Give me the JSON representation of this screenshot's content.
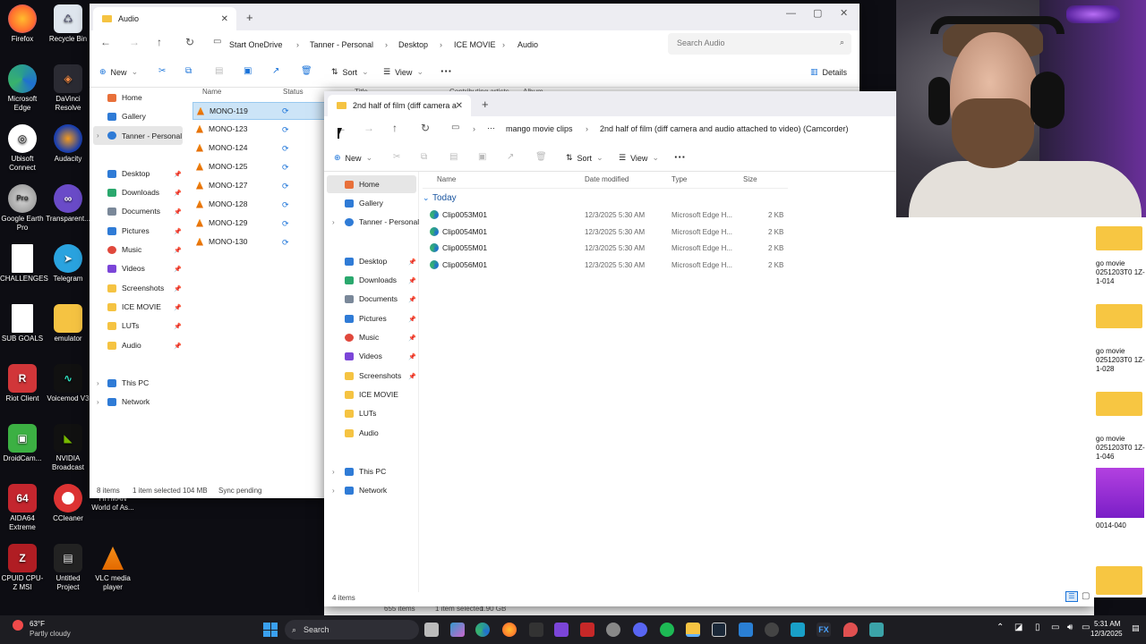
{
  "desktop": {
    "icons_left": [
      "Firefox",
      "Microsoft Edge",
      "Ubisoft Connect",
      "Google Earth Pro",
      "CHALLENGES",
      "SUB GOALS",
      "Riot Client",
      "DroidCam...",
      "AIDA64 Extreme",
      "CPUID CPU-Z MSI"
    ],
    "icons_right": [
      "Recycle Bin",
      "DaVinci Resolve",
      "Audacity",
      "Transparent...",
      "Telegram",
      "emulator",
      "Voicemod V3",
      "NVIDIA Broadcast",
      "CCleaner",
      "Untitled Project"
    ],
    "icons_third": [
      "HITMAN World of As...",
      "VLC media player"
    ]
  },
  "back_window": {
    "tab_title": "Audio",
    "breadcrumbs": [
      "Start OneDrive",
      "Tanner - Personal",
      "Desktop",
      "ICE MOVIE",
      "Audio"
    ],
    "search_placeholder": "Search Audio",
    "commands": {
      "new": "New",
      "sort": "Sort",
      "view": "View",
      "details": "Details"
    },
    "nav": {
      "home": "Home",
      "gallery": "Gallery",
      "onedrive": "Tanner - Personal",
      "quick": [
        "Desktop",
        "Downloads",
        "Documents",
        "Pictures",
        "Music",
        "Videos",
        "Screenshots",
        "ICE MOVIE",
        "LUTs",
        "Audio"
      ],
      "this_pc": "This PC",
      "network": "Network"
    },
    "columns": {
      "name": "Name",
      "status": "Status",
      "title": "Title",
      "contributing": "Contributing artists",
      "album": "Album"
    },
    "files": [
      "MONO-119",
      "MONO-123",
      "MONO-124",
      "MONO-125",
      "MONO-127",
      "MONO-128",
      "MONO-129",
      "MONO-130"
    ],
    "status": {
      "count": "8 items",
      "selected": "1 item selected",
      "size": "104 MB",
      "sync": "Sync pending"
    }
  },
  "front_window": {
    "tab_title": "2nd half of film (diff camera a",
    "breadcrumbs": [
      "mango movie clips",
      "2nd half of film (diff camera and audio attached to video) (Camcorder)"
    ],
    "commands": {
      "new": "New",
      "sort": "Sort",
      "view": "View"
    },
    "nav": {
      "home": "Home",
      "gallery": "Gallery",
      "onedrive": "Tanner - Personal",
      "quick": [
        "Desktop",
        "Downloads",
        "Documents",
        "Pictures",
        "Music",
        "Videos",
        "Screenshots",
        "ICE MOVIE",
        "LUTs",
        "Audio"
      ],
      "this_pc": "This PC",
      "network": "Network"
    },
    "columns": {
      "name": "Name",
      "date": "Date modified",
      "type": "Type",
      "size": "Size"
    },
    "group": "Today",
    "files": [
      {
        "name": "Clip0053M01",
        "date": "12/3/2025 5:30 AM",
        "type": "Microsoft Edge H...",
        "size": "2 KB"
      },
      {
        "name": "Clip0054M01",
        "date": "12/3/2025 5:30 AM",
        "type": "Microsoft Edge H...",
        "size": "2 KB"
      },
      {
        "name": "Clip0055M01",
        "date": "12/3/2025 5:30 AM",
        "type": "Microsoft Edge H...",
        "size": "2 KB"
      },
      {
        "name": "Clip0056M01",
        "date": "12/3/2025 5:30 AM",
        "type": "Microsoft Edge H...",
        "size": "2 KB"
      }
    ],
    "status": {
      "count": "4 items"
    }
  },
  "underlay": {
    "items": "655 items",
    "selected": "1 item selected",
    "size": "1.90 GB"
  },
  "right_strip": [
    "go movie 0251203T0 1Z-1-014",
    "go movie 0251203T0 1Z-1-028",
    "go movie 0251203T0 1Z-1-046",
    "0014-040"
  ],
  "taskbar": {
    "weather_temp": "63°F",
    "weather_desc": "Partly cloudy",
    "search": "Search",
    "time": "5:31 AM",
    "date": "12/3/2025"
  }
}
